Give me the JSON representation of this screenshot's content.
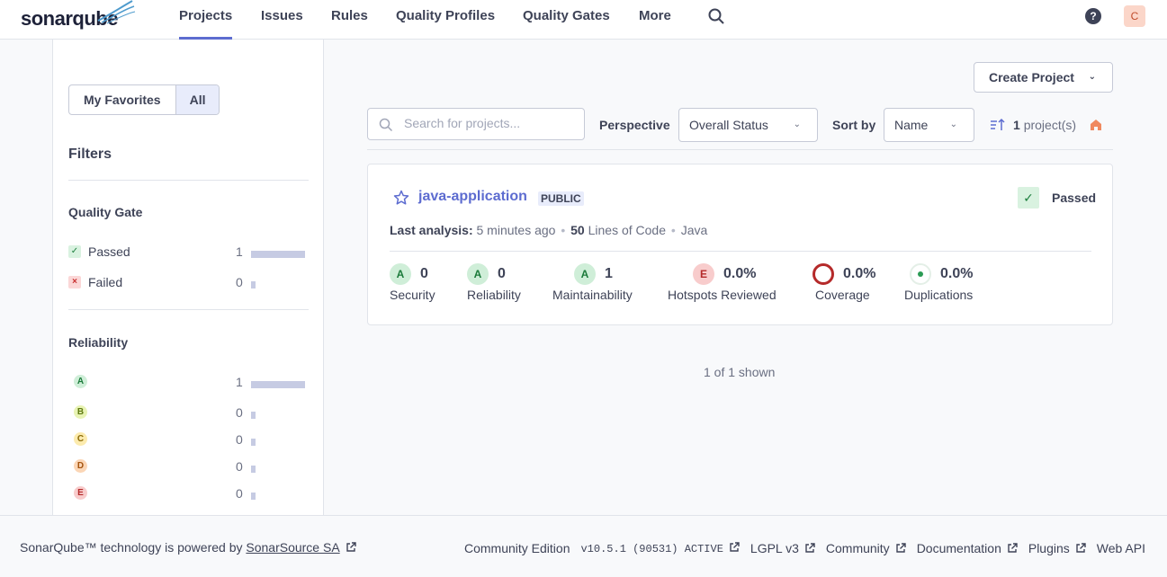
{
  "nav": {
    "logo_left": "sonar",
    "logo_right": "qube",
    "items": [
      {
        "label": "Projects"
      },
      {
        "label": "Issues"
      },
      {
        "label": "Rules"
      },
      {
        "label": "Quality Profiles"
      },
      {
        "label": "Quality Gates"
      },
      {
        "label": "More"
      }
    ],
    "avatar_letter": "C"
  },
  "sidebar": {
    "toggle": {
      "favorites": "My Favorites",
      "all": "All"
    },
    "filters_title": "Filters",
    "quality_gate": {
      "title": "Quality Gate",
      "rows": [
        {
          "label": "Passed",
          "count": "1",
          "fraction": 1.0
        },
        {
          "label": "Failed",
          "count": "0",
          "fraction": 0
        }
      ]
    },
    "reliability": {
      "title": "Reliability",
      "rows": [
        {
          "grade": "A",
          "count": "1",
          "fraction": 1.0
        },
        {
          "grade": "B",
          "count": "0",
          "fraction": 0
        },
        {
          "grade": "C",
          "count": "0",
          "fraction": 0
        },
        {
          "grade": "D",
          "count": "0",
          "fraction": 0
        },
        {
          "grade": "E",
          "count": "0",
          "fraction": 0
        }
      ]
    }
  },
  "toolbar": {
    "create_project": "Create Project",
    "search_placeholder": "Search for projects...",
    "perspective_label": "Perspective",
    "perspective_value": "Overall Status",
    "sort_label": "Sort by",
    "sort_value": "Name",
    "project_count": "1",
    "project_count_suffix": "project(s)"
  },
  "project": {
    "name": "java-application",
    "visibility": "PUBLIC",
    "status": "Passed",
    "last_analysis_label": "Last analysis:",
    "last_analysis_value": "5 minutes ago",
    "loc_value": "50",
    "loc_label": "Lines of Code",
    "language": "Java",
    "metrics": [
      {
        "grade": "A",
        "value": "0",
        "name": "Security"
      },
      {
        "grade": "A",
        "value": "0",
        "name": "Reliability"
      },
      {
        "grade": "A",
        "value": "1",
        "name": "Maintainability"
      },
      {
        "grade": "E",
        "value": "0.0%",
        "name": "Hotspots Reviewed"
      },
      {
        "value": "0.0%",
        "name": "Coverage"
      },
      {
        "value": "0.0%",
        "name": "Duplications"
      }
    ]
  },
  "shown_text": "1 of 1 shown",
  "footer": {
    "powered_prefix": "SonarQube™ technology is powered by",
    "powered_link": "SonarSource SA",
    "edition": "Community Edition",
    "version": "v10.5.1 (90531) ACTIVE",
    "license": "LGPL v3",
    "community": "Community",
    "documentation": "Documentation",
    "plugins": "Plugins",
    "web_api": "Web API"
  },
  "colors": {
    "accent": "#5d6cd0",
    "passed": "#1d7f3e",
    "failed": "#c82f2f"
  }
}
